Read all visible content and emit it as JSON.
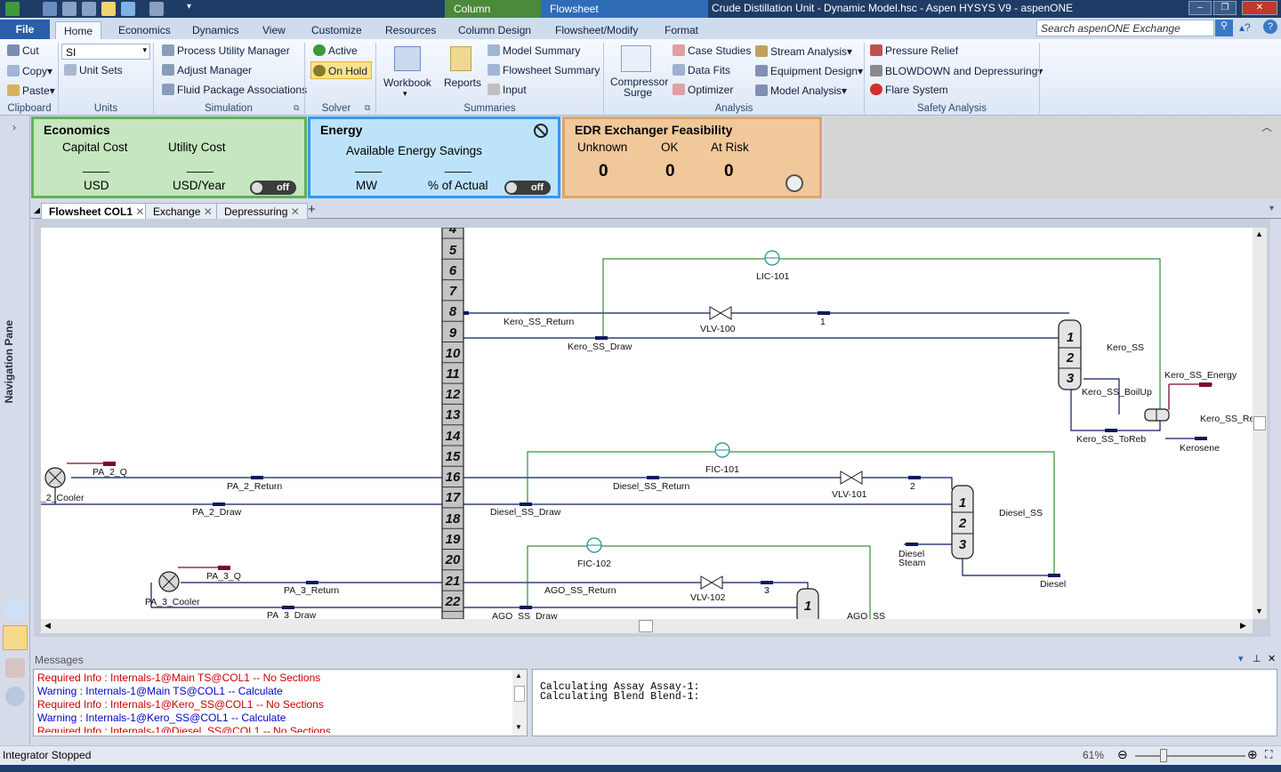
{
  "window": {
    "title": "Crude Distillation Unit - Dynamic Model.hsc - Aspen HYSYS V9 - aspenONE",
    "context_tabs": [
      "Column",
      "Flowsheet"
    ]
  },
  "ribbon": {
    "file_tab": "File",
    "tabs": [
      "Home",
      "Economics",
      "Dynamics",
      "View",
      "Customize",
      "Resources",
      "Column Design",
      "Flowsheet/Modify",
      "Format"
    ],
    "search_placeholder": "Search aspenONE Exchange",
    "clipboard": {
      "cut": "Cut",
      "copy": "Copy",
      "paste": "Paste",
      "label": "Clipboard"
    },
    "units": {
      "value": "SI",
      "unit_sets": "Unit Sets",
      "label": "Units"
    },
    "simulation": {
      "process_utility": "Process Utility Manager",
      "adjust": "Adjust Manager",
      "fluid_package": "Fluid Package Associations",
      "label": "Simulation"
    },
    "solver": {
      "active": "Active",
      "on_hold": "On Hold",
      "label": "Solver"
    },
    "summaries": {
      "workbook": "Workbook",
      "reports": "Reports",
      "model_summary": "Model Summary",
      "flowsheet_summary": "Flowsheet Summary",
      "input": "Input",
      "label": "Summaries"
    },
    "analysis": {
      "compressor": "Compressor",
      "surge": "Surge",
      "case_studies": "Case Studies",
      "data_fits": "Data Fits",
      "optimizer": "Optimizer",
      "stream_analysis": "Stream Analysis",
      "equipment_design": "Equipment Design",
      "model_analysis": "Model Analysis",
      "label": "Analysis"
    },
    "safety": {
      "pressure_relief": "Pressure Relief",
      "blowdown": "BLOWDOWN and Depressuring",
      "flare": "Flare System",
      "label": "Safety Analysis"
    }
  },
  "nav": {
    "pane_label": "Navigation Pane"
  },
  "dashboard": {
    "economics": {
      "title": "Economics",
      "capital_label": "Capital Cost",
      "utility_label": "Utility Cost",
      "capital_value": "____",
      "utility_value": "____",
      "capital_unit": "USD",
      "utility_unit": "USD/Year",
      "toggle": "off"
    },
    "energy": {
      "title": "Energy",
      "savings_label": "Available Energy Savings",
      "mw_value": "____",
      "pct_value": "____",
      "mw_unit": "MW",
      "pct_unit": "% of Actual",
      "toggle": "off"
    },
    "edr": {
      "title": "EDR Exchanger Feasibility",
      "unknown_label": "Unknown",
      "ok_label": "OK",
      "risk_label": "At Risk",
      "unknown": "0",
      "ok": "0",
      "risk": "0"
    }
  },
  "doc_tabs": [
    "Flowsheet COL1",
    "Exchange",
    "Depressuring"
  ],
  "flowsheet": {
    "stage_numbers": [
      "4",
      "5",
      "6",
      "7",
      "8",
      "9",
      "10",
      "11",
      "12",
      "13",
      "14",
      "15",
      "16",
      "17",
      "18",
      "19",
      "20",
      "21",
      "22"
    ],
    "labels": {
      "lic101": "LIC-101",
      "kero_return": "Kero_SS_Return",
      "vlv100": "VLV-100",
      "s1": "1",
      "kero_draw": "Kero_SS_Draw",
      "kero_ss": "Kero_SS",
      "kero_energy": "Kero_SS_Energy",
      "kero_boilup": "Kero_SS_BoilUp",
      "kero_re": "Kero_SS_Re",
      "kero_toreb": "Kero_SS_ToReb",
      "kerosene": "Kerosene",
      "fic101": "FIC-101",
      "pa2q": "PA_2_Q",
      "pa2return": "PA_2_Return",
      "pa2cooler": "_2_Cooler",
      "pa2draw": "PA_2_Draw",
      "diesel_return": "Diesel_SS_Return",
      "vlv101": "VLV-101",
      "s2": "2",
      "diesel_draw": "Diesel_SS_Draw",
      "diesel_ss": "Diesel_SS",
      "diesel_steam1": "Diesel",
      "diesel_steam2": "Steam",
      "diesel": "Diesel",
      "fic102": "FIC-102",
      "pa3q": "PA_3_Q",
      "pa3return": "PA_3_Return",
      "pa3cooler": "PA_3_Cooler",
      "pa3draw": "PA_3_Draw",
      "ago_return": "AGO_SS_Return",
      "vlv102": "VLV-102",
      "s3": "3",
      "ago_draw": "AGO_SS_Draw",
      "ago_ss": "AGO_SS",
      "col_1": "1",
      "col_2": "2",
      "col_3": "3"
    }
  },
  "messages": {
    "header": "Messages",
    "left": [
      {
        "text": "Required Info : Internals-1@Main TS@COL1 -- No Sections",
        "color": "#cc0000"
      },
      {
        "text": "Warning  : Internals-1@Main TS@COL1 -- Calculate",
        "color": "#0000cc"
      },
      {
        "text": "Required Info : Internals-1@Kero_SS@COL1 -- No Sections",
        "color": "#cc0000"
      },
      {
        "text": "Warning  : Internals-1@Kero_SS@COL1 -- Calculate",
        "color": "#0000cc"
      },
      {
        "text": "Required Info : Internals-1@Diesel_SS@COL1 -- No Sections",
        "color": "#cc0000"
      }
    ],
    "right": [
      "Calculating Assay Assay-1:",
      "Calculating Blend Blend-1:"
    ]
  },
  "status": {
    "text": "Integrator Stopped",
    "zoom": "61%"
  }
}
